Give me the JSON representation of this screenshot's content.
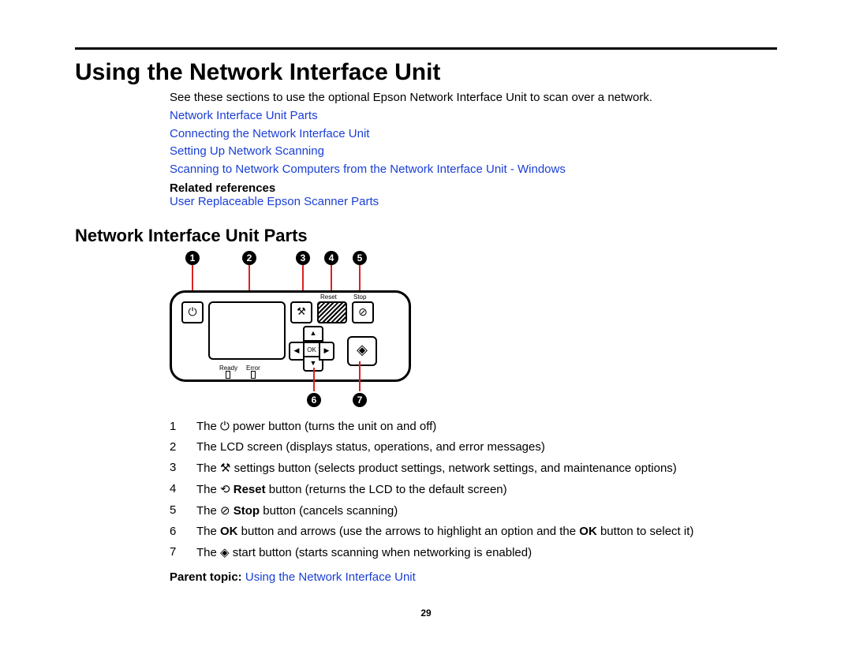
{
  "heading": "Using the Network Interface Unit",
  "intro": "See these sections to use the optional Epson Network Interface Unit to scan over a network.",
  "links": [
    "Network Interface Unit Parts",
    "Connecting the Network Interface Unit",
    "Setting Up Network Scanning",
    "Scanning to Network Computers from the Network Interface Unit - Windows"
  ],
  "related_head": "Related references",
  "related_link": "User Replaceable Epson Scanner Parts",
  "subheading": "Network Interface Unit Parts",
  "diagram": {
    "callout_labels": [
      "1",
      "2",
      "3",
      "4",
      "5",
      "6",
      "7"
    ],
    "panel_labels": {
      "reset": "Reset",
      "stop": "Stop",
      "ok": "OK",
      "ready": "Ready",
      "error": "Error"
    }
  },
  "parts": [
    {
      "n": "1",
      "pre": "The ",
      "sym": "⏻",
      "post": " power button (turns the unit on and off)"
    },
    {
      "n": "2",
      "pre": "The LCD screen (displays status, operations, and error messages)",
      "sym": "",
      "post": ""
    },
    {
      "n": "3",
      "pre": "The ",
      "sym": "⚒",
      "post": " settings button (selects product settings, network settings, and maintenance options)"
    },
    {
      "n": "4",
      "pre": "The ",
      "sym": "⟲",
      "bold": " Reset",
      "post": " button (returns the LCD to the default screen)"
    },
    {
      "n": "5",
      "pre": "The ",
      "sym": "⊘",
      "bold": " Stop",
      "post": " button (cancels scanning)"
    },
    {
      "n": "6",
      "pre": "The ",
      "bold1": "OK",
      "mid": " button and arrows (use the arrows to highlight an option and the ",
      "bold2": "OK",
      "post": " button to select it)"
    },
    {
      "n": "7",
      "pre": "The ",
      "sym": "◈",
      "post": " start button (starts scanning when networking is enabled)"
    }
  ],
  "parent_head": "Parent topic: ",
  "parent_link": "Using the Network Interface Unit",
  "page_number": "29"
}
